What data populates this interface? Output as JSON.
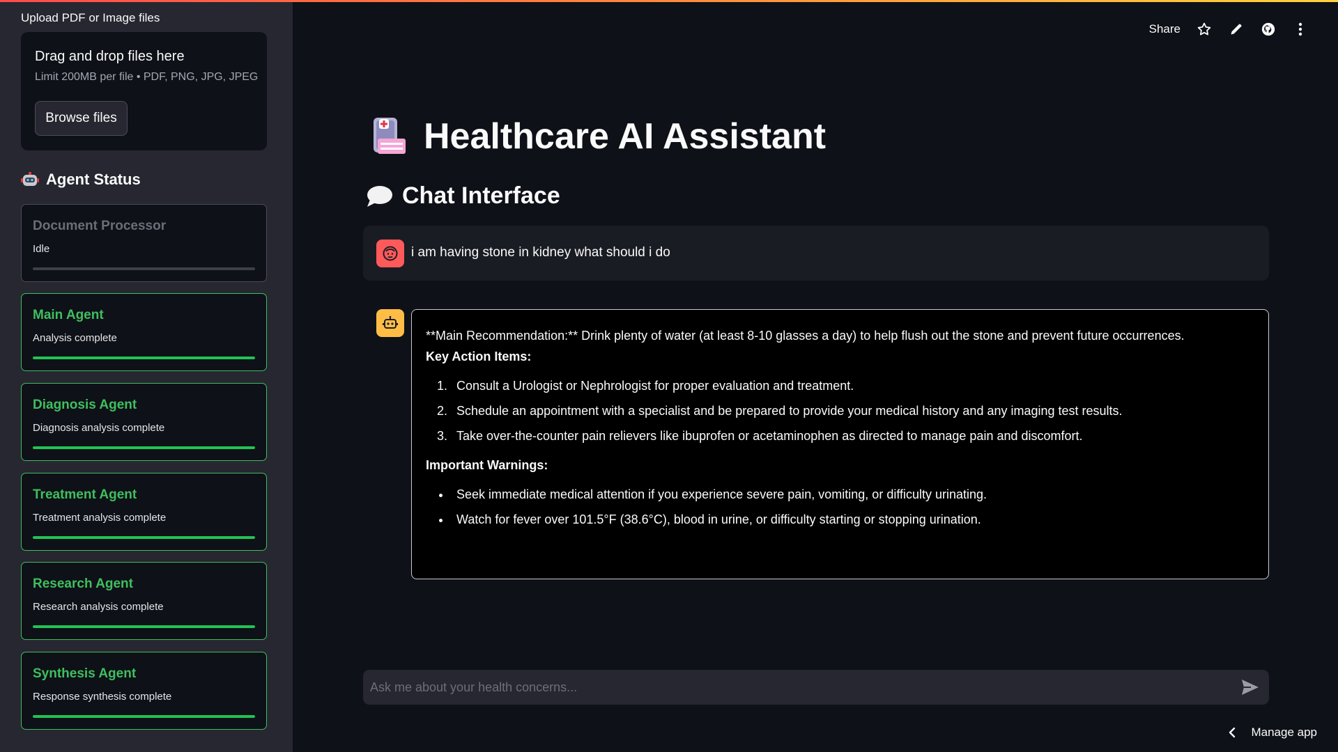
{
  "sidebar": {
    "upload_label": "Upload PDF or Image files",
    "dropzone": {
      "title": "Drag and drop files here",
      "limit": "Limit 200MB per file • PDF, PNG, JPG, JPEG",
      "browse_label": "Browse files"
    },
    "status_heading": "Agent Status",
    "agents": [
      {
        "name": "Document Processor",
        "status": "Idle",
        "progress": 0
      },
      {
        "name": "Main Agent",
        "status": "Analysis complete",
        "progress": 1
      },
      {
        "name": "Diagnosis Agent",
        "status": "Diagnosis analysis complete",
        "progress": 1
      },
      {
        "name": "Treatment Agent",
        "status": "Treatment analysis complete",
        "progress": 1
      },
      {
        "name": "Research Agent",
        "status": "Research analysis complete",
        "progress": 1
      },
      {
        "name": "Synthesis Agent",
        "status": "Response synthesis complete",
        "progress": 1
      }
    ]
  },
  "toolbar": {
    "share_label": "Share",
    "icons": [
      "star-icon",
      "pencil-icon",
      "github-icon",
      "more-vertical-icon"
    ]
  },
  "main": {
    "title": "Healthcare AI Assistant",
    "subtitle": "Chat Interface",
    "user_message": "i am having stone in kidney what should i do",
    "bot_response": {
      "recommendation": "**Main Recommendation:** Drink plenty of water (at least 8-10 glasses a day) to help flush out the stone and prevent future occurrences.",
      "actions_heading": "Key Action Items:",
      "actions": [
        "Consult a Urologist or Nephrologist for proper evaluation and treatment.",
        "Schedule an appointment with a specialist and be prepared to provide your medical history and any imaging test results.",
        "Take over-the-counter pain relievers like ibuprofen or acetaminophen as directed to manage pain and discomfort."
      ],
      "warnings_heading": "Important Warnings:",
      "warnings": [
        "Seek immediate medical attention if you experience severe pain, vomiting, or difficulty urinating.",
        "Watch for fever over 101.5°F (38.6°C), blood in urine, or difficulty starting or stopping urination."
      ]
    },
    "chat_placeholder": "Ask me about your health concerns...",
    "manage_app_label": "Manage app"
  },
  "colors": {
    "background": "#0e1117",
    "sidebar": "#262730",
    "success": "#21c354",
    "agent_name": "#3fbf5f",
    "user_avatar": "#ff5a5a",
    "bot_avatar": "#ffbd45"
  }
}
